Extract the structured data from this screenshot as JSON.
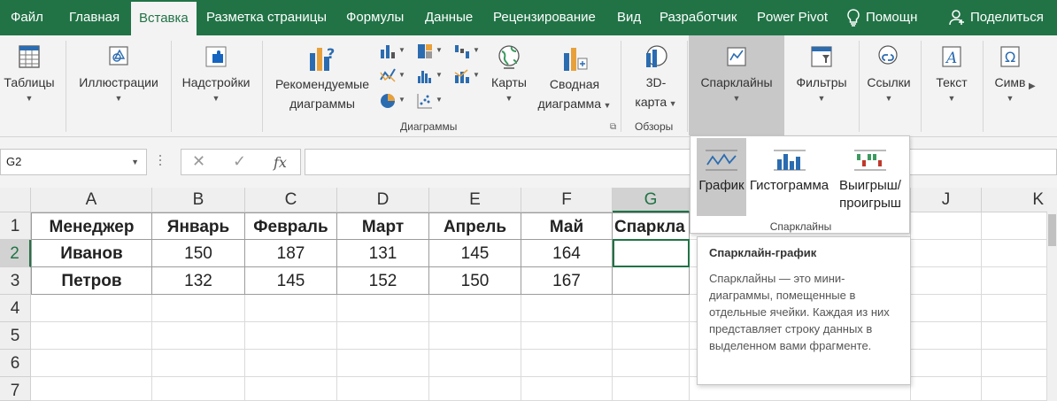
{
  "menu": {
    "tabs": [
      "Файл",
      "Главная",
      "Вставка",
      "Разметка страницы",
      "Формулы",
      "Данные",
      "Рецензирование",
      "Вид",
      "Разработчик",
      "Power Pivot"
    ],
    "active_tab": "Вставка",
    "help": "Помощн",
    "share": "Поделиться"
  },
  "ribbon": {
    "tables": "Таблицы",
    "illustrations": "Иллюстрации",
    "addins": "Надстройки",
    "recommended_charts_1": "Рекомендуемые",
    "recommended_charts_2": "диаграммы",
    "maps": "Карты",
    "pivot_chart_1": "Сводная",
    "pivot_chart_2": "диаграмма",
    "map3d_1": "3D-",
    "map3d_2": "карта",
    "sparklines": "Спарклайны",
    "filters": "Фильтры",
    "links": "Ссылки",
    "text": "Текст",
    "symbols": "Симв",
    "group_charts": "Диаграммы",
    "group_tours": "Обзоры"
  },
  "formula_bar": {
    "name_box": "G2",
    "fx": "fx",
    "content": ""
  },
  "grid": {
    "columns": [
      "A",
      "B",
      "C",
      "D",
      "E",
      "F",
      "G",
      "",
      "J",
      "K"
    ],
    "rows": [
      "1",
      "2",
      "3",
      "4",
      "5",
      "6",
      "7"
    ],
    "header": [
      "Менеджер",
      "Январь",
      "Февраль",
      "Март",
      "Апрель",
      "Май",
      "Спаркла"
    ],
    "data": [
      {
        "name": "Иванов",
        "values": [
          "150",
          "187",
          "131",
          "145",
          "164"
        ]
      },
      {
        "name": "Петров",
        "values": [
          "132",
          "145",
          "152",
          "150",
          "167"
        ]
      }
    ],
    "active_cell": "G2"
  },
  "dropdown": {
    "items": [
      {
        "label": "График",
        "label2": ""
      },
      {
        "label": "Гистограмма",
        "label2": ""
      },
      {
        "label": "Выигрыш/",
        "label2": "проигрыш"
      }
    ],
    "group_label": "Спарклайны"
  },
  "tooltip": {
    "title": "Спарклайн-график",
    "body": "Спарклайны — это мини-диаграммы, помещенные в отдельные ячейки. Каждая из них представляет строку данных в выделенном вами фрагменте."
  },
  "colors": {
    "brand": "#217346",
    "ribbon": "#f3f3f3",
    "selected": "#c8c8c8",
    "blue": "#2b6cb0",
    "orange": "#e8a13a"
  }
}
